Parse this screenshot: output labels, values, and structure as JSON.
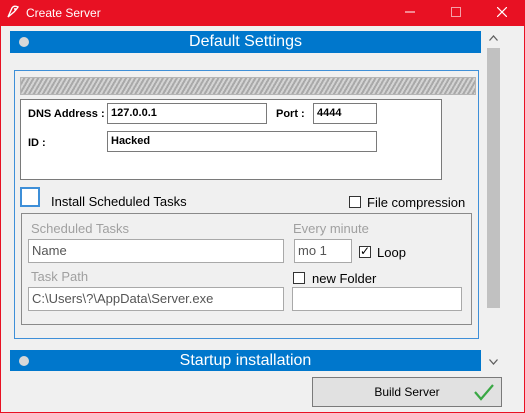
{
  "window": {
    "title": "Create Server",
    "accent_color": "#e81123",
    "controls": {
      "minimize": "minimize-icon",
      "maximize": "maximize-icon",
      "close": "close-icon"
    }
  },
  "sections": {
    "default_settings": "Default Settings",
    "startup_installation": "Startup installation"
  },
  "connection": {
    "dns_label": "DNS Address :",
    "dns_value": "127.0.0.1",
    "port_label": "Port :",
    "port_value": "4444",
    "id_label": "ID :",
    "id_value": "Hacked"
  },
  "options": {
    "install_scheduled_tasks": {
      "label": "Install Scheduled Tasks",
      "checked": false
    },
    "file_compression": {
      "label": "File compression",
      "checked": false
    }
  },
  "scheduled": {
    "tasks_label": "Scheduled Tasks",
    "name_value": "Name",
    "every_label": "Every minute",
    "every_value": "mo 1",
    "loop_label": "Loop",
    "loop_checked": true,
    "task_path_label": "Task Path",
    "task_path_value": "C:\\Users\\?\\AppData\\Server.exe",
    "new_folder_label": "new Folder",
    "new_folder_checked": false,
    "new_folder_value": ""
  },
  "build_button": {
    "label": "Build Server",
    "icon": "checkmark-icon",
    "icon_color": "#3aa845"
  },
  "section_color": "#0077cc"
}
